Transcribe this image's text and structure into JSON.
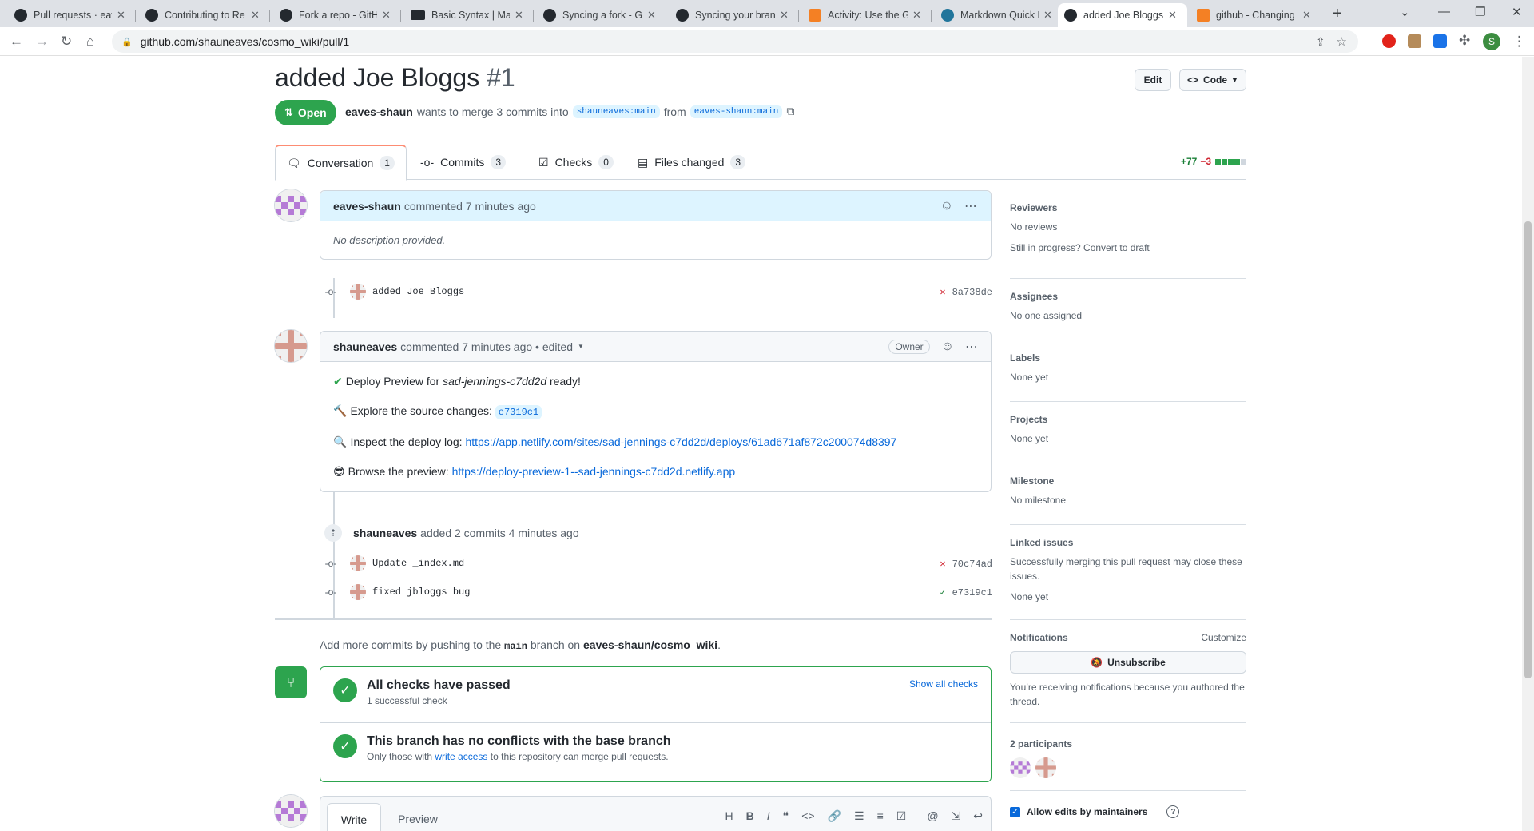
{
  "browser": {
    "tabs": [
      {
        "title": "Pull requests · eave",
        "icon": "github-icon"
      },
      {
        "title": "Contributing to Re",
        "icon": "github-icon"
      },
      {
        "title": "Fork a repo - GitH",
        "icon": "github-icon"
      },
      {
        "title": "Basic Syntax | Mark",
        "icon": "markdown-icon"
      },
      {
        "title": "Syncing a fork - Gi",
        "icon": "github-icon"
      },
      {
        "title": "Syncing your branc",
        "icon": "github-icon"
      },
      {
        "title": "Activity: Use the Gi",
        "icon": "activity-icon"
      },
      {
        "title": "Markdown Quick R",
        "icon": "wordpress-icon"
      },
      {
        "title": "added Joe Bloggs",
        "icon": "github-icon",
        "active": true
      },
      {
        "title": "github - Changing",
        "icon": "stackoverflow-icon"
      }
    ],
    "url": "github.com/shauneaves/cosmo_wiki/pull/1",
    "profile_initial": "S"
  },
  "pr": {
    "title": "added Joe Bloggs",
    "number": "#1",
    "edit_label": "Edit",
    "code_label": "Code",
    "state": "Open",
    "author": "eaves-shaun",
    "merge_text": "wants to merge 3 commits into",
    "base_branch": "shauneaves:main",
    "from_text": "from",
    "head_branch": "eaves-shaun:main"
  },
  "tabs": [
    {
      "label": "Conversation",
      "count": "1"
    },
    {
      "label": "Commits",
      "count": "3"
    },
    {
      "label": "Checks",
      "count": "0"
    },
    {
      "label": "Files changed",
      "count": "3"
    }
  ],
  "diffstat": {
    "added": "+77",
    "removed": "−3",
    "colors": {
      "add": "#2da44e",
      "del": "#cf222e"
    }
  },
  "comment1": {
    "author": "eaves-shaun",
    "meta": "commented 7 minutes ago",
    "body": "No description provided."
  },
  "commit1": {
    "message": "added Joe Bloggs",
    "sha": "8a738de",
    "status": "failed"
  },
  "comment2": {
    "author": "shauneaves",
    "meta": "commented 7 minutes ago • edited",
    "badge": "Owner",
    "line1_pre": "Deploy Preview for ",
    "line1_em": "sad-jennings-c7dd2d",
    "line1_post": " ready!",
    "line2_pre": "Explore the source changes: ",
    "line2_code": "e7319c1",
    "line3_pre": "Inspect the deploy log: ",
    "line3_link": "https://app.netlify.com/sites/sad-jennings-c7dd2d/deploys/61ad671af872c200074d8397",
    "line4_pre": "Browse the preview: ",
    "line4_link": "https://deploy-preview-1--sad-jennings-c7dd2d.netlify.app"
  },
  "push_event": {
    "author": "shauneaves",
    "text": "added 2 commits 4 minutes ago"
  },
  "commit2": {
    "message": "Update _index.md",
    "sha": "70c74ad",
    "status": "failed"
  },
  "commit3": {
    "message": "fixed jbloggs bug",
    "sha": "e7319c1",
    "status": "passed"
  },
  "push_hint": {
    "pre": "Add more commits by pushing to the",
    "branch": "main",
    "mid": "branch on",
    "repo": "eaves-shaun/cosmo_wiki",
    "post": "."
  },
  "merge": {
    "checks_title": "All checks have passed",
    "checks_sub": "1 successful check",
    "show_checks": "Show all checks",
    "conflict_title": "This branch has no conflicts with the base branch",
    "conflict_sub_pre": "Only those with",
    "conflict_link": "write access",
    "conflict_sub_post": "to this repository can merge pull requests."
  },
  "editor": {
    "write_tab": "Write",
    "preview_tab": "Preview"
  },
  "sidebar": {
    "reviewers_h": "Reviewers",
    "reviewers_v": "No reviews",
    "reviewers_draft": "Still in progress? Convert to draft",
    "assignees_h": "Assignees",
    "assignees_v": "No one assigned",
    "labels_h": "Labels",
    "labels_v": "None yet",
    "projects_h": "Projects",
    "projects_v": "None yet",
    "milestone_h": "Milestone",
    "milestone_v": "No milestone",
    "linked_h": "Linked issues",
    "linked_t": "Successfully merging this pull request may close these issues.",
    "linked_v": "None yet",
    "notif_h": "Notifications",
    "notif_customize": "Customize",
    "notif_btn": "Unsubscribe",
    "notif_t": "You’re receiving notifications because you authored the thread.",
    "participants_h": "2 participants",
    "allow_edits": "Allow edits by maintainers"
  }
}
